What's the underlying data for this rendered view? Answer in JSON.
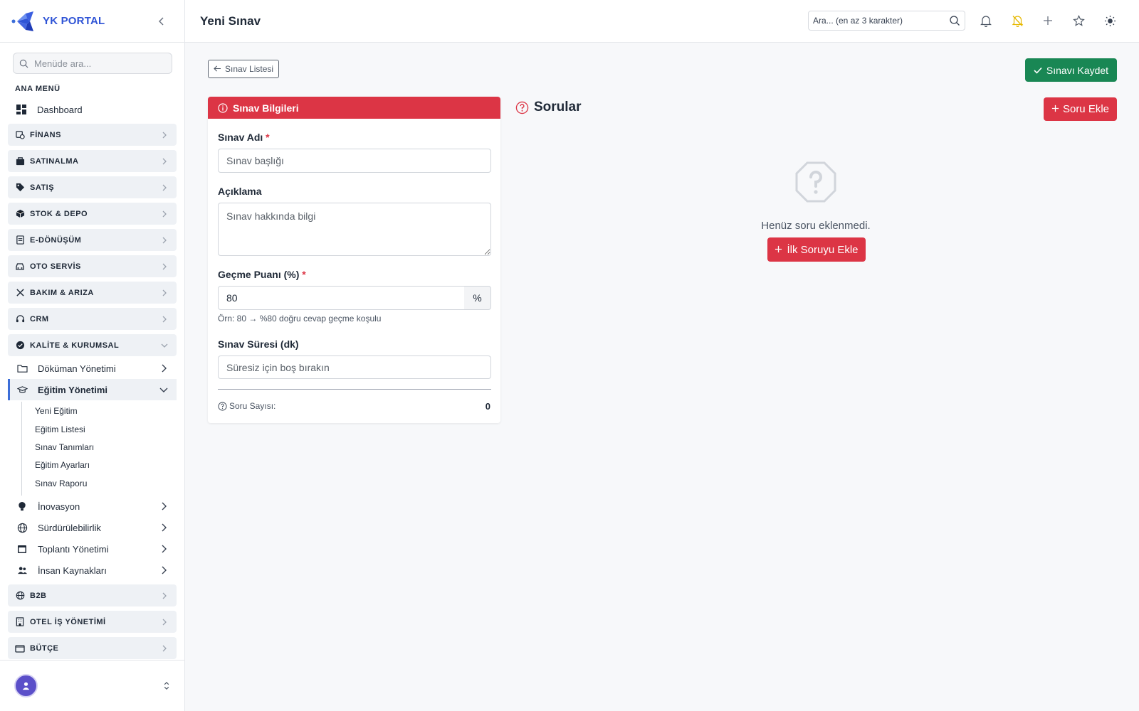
{
  "brand": {
    "name": "YK PORTAL"
  },
  "menu_search": {
    "placeholder": "Menüde ara..."
  },
  "sidebar": {
    "section_title": "ANA MENÜ",
    "dashboard": "Dashboard",
    "groups_top": [
      {
        "label": "FİNANS",
        "icon": "finance-icon"
      },
      {
        "label": "SATINALMA",
        "icon": "bag-icon"
      },
      {
        "label": "SATIŞ",
        "icon": "tag-icon"
      },
      {
        "label": "STOK & DEPO",
        "icon": "box-icon"
      },
      {
        "label": "E-DÖNÜŞÜM",
        "icon": "document-icon"
      },
      {
        "label": "OTO SERVİS",
        "icon": "car-icon"
      },
      {
        "label": "BAKIM & ARIZA",
        "icon": "tools-icon"
      },
      {
        "label": "CRM",
        "icon": "headset-icon"
      },
      {
        "label": "KALİTE & KURUMSAL",
        "icon": "badge-icon"
      }
    ],
    "sub_items": [
      {
        "label": "Döküman Yönetimi",
        "icon": "folder-icon"
      },
      {
        "label": "Eğitim Yönetimi",
        "icon": "graduation-icon"
      },
      {
        "label": "İnovasyon",
        "icon": "bulb-icon"
      },
      {
        "label": "Sürdürülebilirlik",
        "icon": "globe-icon"
      },
      {
        "label": "Toplantı Yönetimi",
        "icon": "calendar-icon"
      },
      {
        "label": "İnsan Kaynakları",
        "icon": "people-icon"
      }
    ],
    "leaves": [
      "Yeni Eğitim",
      "Eğitim Listesi",
      "Sınav Tanımları",
      "Eğitim Ayarları",
      "Sınav Raporu"
    ],
    "groups_bottom": [
      {
        "label": "B2B",
        "icon": "globe-icon"
      },
      {
        "label": "OTEL İŞ YÖNETİMİ",
        "icon": "building-icon"
      },
      {
        "label": "BÜTÇE",
        "icon": "wallet-icon"
      }
    ]
  },
  "header": {
    "title": "Yeni Sınav",
    "search_placeholder": "Ara... (en az 3 karakter)"
  },
  "toolbar": {
    "back_label": "Sınav Listesi",
    "save_label": "Sınavı Kaydet"
  },
  "form": {
    "card_title": "Sınav Bilgileri",
    "name_label": "Sınav Adı",
    "name_placeholder": "Sınav başlığı",
    "desc_label": "Açıklama",
    "desc_placeholder": "Sınav hakkında bilgi",
    "pass_label": "Geçme Puanı (%)",
    "pass_value": "80",
    "pass_unit": "%",
    "pass_hint": "Örn: 80 → %80 doğru cevap geçme koşulu",
    "duration_label": "Sınav Süresi (dk)",
    "duration_placeholder": "Süresiz için boş bırakın",
    "question_count_label": "Soru Sayısı:",
    "question_count": "0",
    "required_mark": "*"
  },
  "questions": {
    "title": "Sorular",
    "add_label": "Soru Ekle",
    "empty_text": "Henüz soru eklenmedi.",
    "first_add_label": "İlk Soruyu Ekle"
  },
  "colors": {
    "brand": "#2f54d6",
    "danger": "#dc3545",
    "success": "#198754",
    "accent_warning": "#e6b800"
  }
}
